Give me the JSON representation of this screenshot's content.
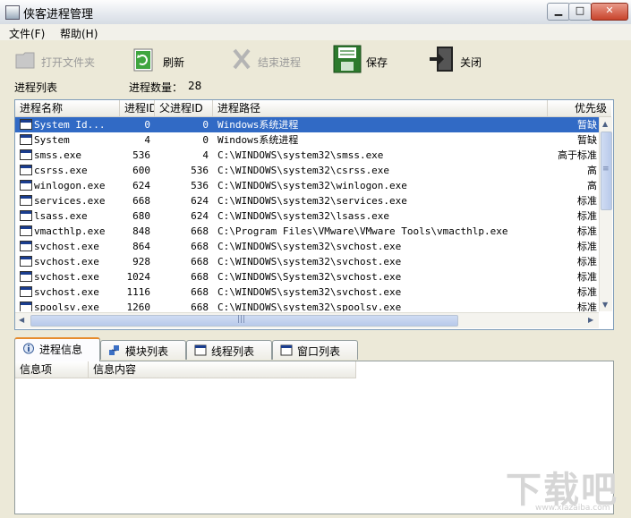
{
  "window": {
    "title": "侠客进程管理"
  },
  "menu": [
    {
      "label": "文件(F)"
    },
    {
      "label": "帮助(H)"
    }
  ],
  "toolbar": {
    "open_folder": "打开文件夹",
    "refresh": "刷新",
    "end_process": "结束进程",
    "save": "保存",
    "close": "关闭"
  },
  "process_list": {
    "title": "进程列表",
    "count_label": "进程数量：",
    "count": "28",
    "columns": [
      "进程名称",
      "进程ID",
      "父进程ID",
      "进程路径",
      "优先级"
    ],
    "rows": [
      {
        "name": "System Id...",
        "pid": "0",
        "ppid": "0",
        "path": "Windows系统进程",
        "priority": "暂缺"
      },
      {
        "name": "System",
        "pid": "4",
        "ppid": "0",
        "path": "Windows系统进程",
        "priority": "暂缺"
      },
      {
        "name": "smss.exe",
        "pid": "536",
        "ppid": "4",
        "path": "C:\\WINDOWS\\system32\\smss.exe",
        "priority": "高于标准"
      },
      {
        "name": "csrss.exe",
        "pid": "600",
        "ppid": "536",
        "path": "C:\\WINDOWS\\system32\\csrss.exe",
        "priority": "高"
      },
      {
        "name": "winlogon.exe",
        "pid": "624",
        "ppid": "536",
        "path": "C:\\WINDOWS\\system32\\winlogon.exe",
        "priority": "高"
      },
      {
        "name": "services.exe",
        "pid": "668",
        "ppid": "624",
        "path": "C:\\WINDOWS\\system32\\services.exe",
        "priority": "标准"
      },
      {
        "name": "lsass.exe",
        "pid": "680",
        "ppid": "624",
        "path": "C:\\WINDOWS\\system32\\lsass.exe",
        "priority": "标准"
      },
      {
        "name": "vmacthlp.exe",
        "pid": "848",
        "ppid": "668",
        "path": "C:\\Program Files\\VMware\\VMware Tools\\vmacthlp.exe",
        "priority": "标准"
      },
      {
        "name": "svchost.exe",
        "pid": "864",
        "ppid": "668",
        "path": "C:\\WINDOWS\\system32\\svchost.exe",
        "priority": "标准"
      },
      {
        "name": "svchost.exe",
        "pid": "928",
        "ppid": "668",
        "path": "C:\\WINDOWS\\system32\\svchost.exe",
        "priority": "标准"
      },
      {
        "name": "svchost.exe",
        "pid": "1024",
        "ppid": "668",
        "path": "C:\\WINDOWS\\System32\\svchost.exe",
        "priority": "标准"
      },
      {
        "name": "svchost.exe",
        "pid": "1116",
        "ppid": "668",
        "path": "C:\\WINDOWS\\system32\\svchost.exe",
        "priority": "标准"
      },
      {
        "name": "spoolsv.exe",
        "pid": "1260",
        "ppid": "668",
        "path": "C:\\WINDOWS\\system32\\spoolsv.exe",
        "priority": "标准"
      }
    ]
  },
  "tabs": [
    {
      "label": "进程信息",
      "icon": "info-icon",
      "active": true
    },
    {
      "label": "模块列表",
      "icon": "module-icon",
      "active": false
    },
    {
      "label": "线程列表",
      "icon": "thread-icon",
      "active": false
    },
    {
      "label": "窗口列表",
      "icon": "window-icon",
      "active": false
    }
  ],
  "info_panel": {
    "columns": [
      "信息项",
      "信息内容"
    ]
  },
  "watermark": {
    "text": "下载吧",
    "url": "www.xiazaiba.com"
  },
  "colors": {
    "selection": "#316ac5",
    "face": "#ece9d8",
    "tab_accent": "#e68b2c"
  }
}
